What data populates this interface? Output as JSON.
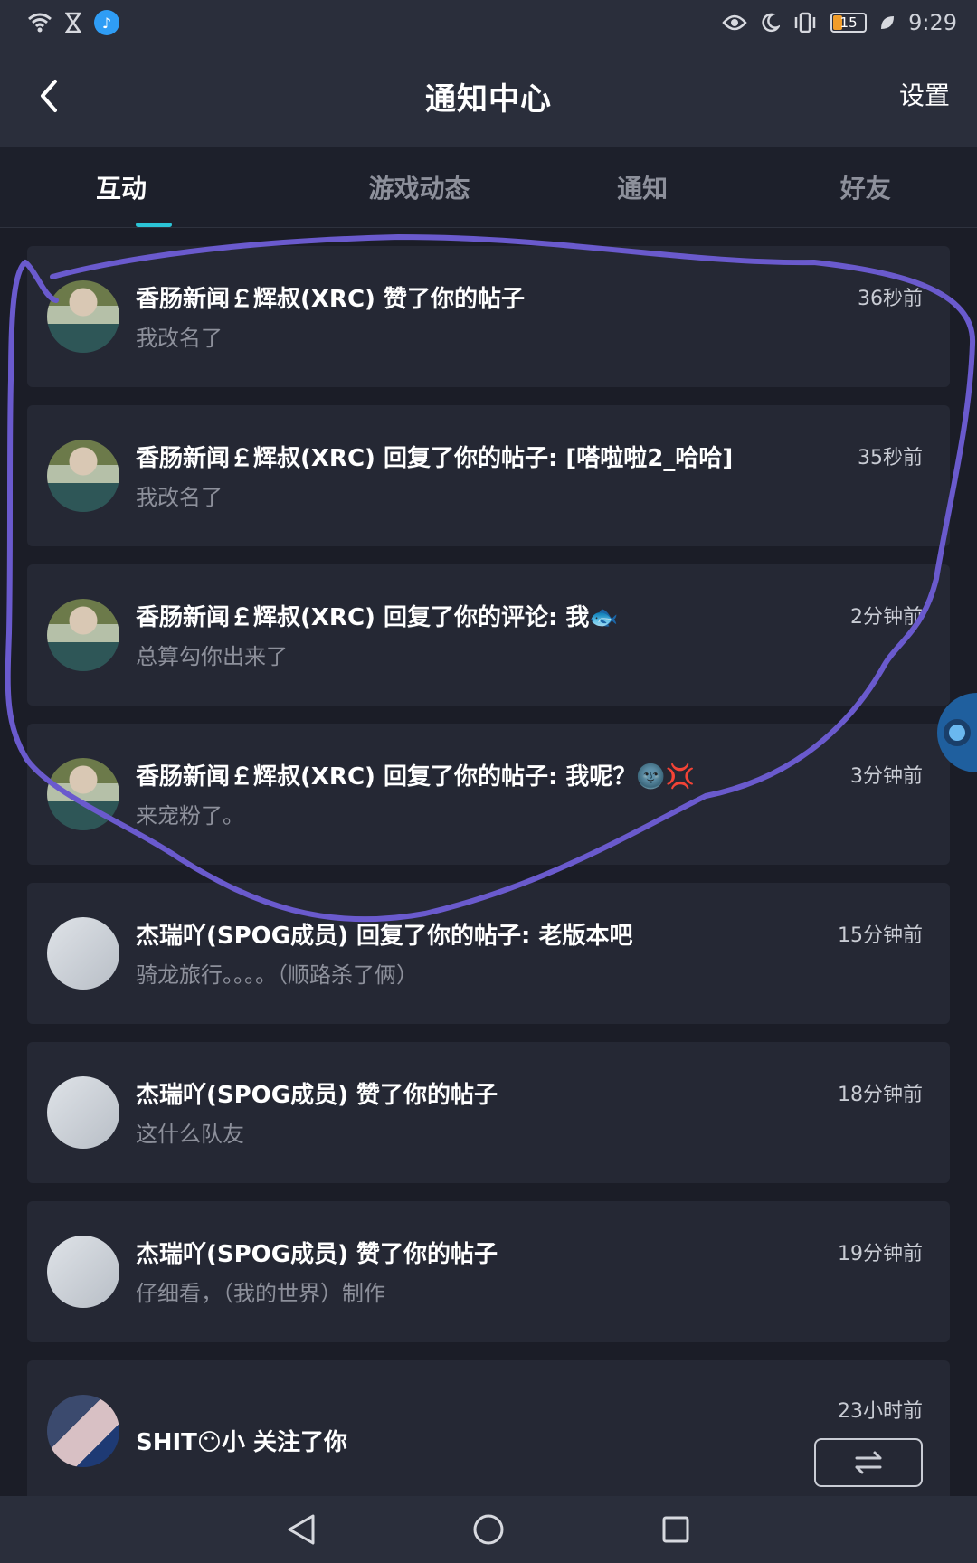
{
  "status_bar": {
    "time": "9:29",
    "battery": "15",
    "icons": [
      "wifi-icon",
      "hourglass-icon",
      "app-notification-icon",
      "eye-icon",
      "moon-icon",
      "vibrate-icon",
      "leaf-icon"
    ]
  },
  "header": {
    "title": "通知中心",
    "settings_label": "设置",
    "back_icon": "chevron-left-icon"
  },
  "tabs": [
    {
      "label": "互动",
      "active": true
    },
    {
      "label": "游戏动态",
      "active": false
    },
    {
      "label": "通知",
      "active": false
    },
    {
      "label": "好友",
      "active": false
    }
  ],
  "notifications": [
    {
      "title": "香肠新闻￡辉叔(XRC) 赞了你的帖子",
      "sub": "我改名了",
      "time": "36秒前",
      "avatar": "a1"
    },
    {
      "title": "香肠新闻￡辉叔(XRC) 回复了你的帖子: [嗒啦啦2_哈哈]",
      "sub": "我改名了",
      "time": "35秒前",
      "avatar": "a1"
    },
    {
      "title": "香肠新闻￡辉叔(XRC) 回复了你的评论: 我🐟",
      "sub": "总算勾你出来了",
      "time": "2分钟前",
      "avatar": "a1"
    },
    {
      "title": "香肠新闻￡辉叔(XRC) 回复了你的帖子: 我呢？🌚💢",
      "sub": "来宠粉了。",
      "time": "3分钟前",
      "avatar": "a1"
    },
    {
      "title": "杰瑞吖(SPOG成员) 回复了你的帖子: 老版本吧",
      "sub": "骑龙旅行。。。。（顺路杀了俩）",
      "time": "15分钟前",
      "avatar": "a2"
    },
    {
      "title": "杰瑞吖(SPOG成员) 赞了你的帖子",
      "sub": "这什么队友",
      "time": "18分钟前",
      "avatar": "a2"
    },
    {
      "title": "杰瑞吖(SPOG成员) 赞了你的帖子",
      "sub": "仔细看，（我的世界）制作",
      "time": "19分钟前",
      "avatar": "a2"
    }
  ],
  "last_notification": {
    "title": "SHIT😶小 关注了你",
    "time": "23小时前",
    "avatar": "a3"
  },
  "colors": {
    "accent": "#2bc4d6",
    "annotation": "#6a5acd",
    "background": "#1b1d27",
    "card": "#252834"
  }
}
